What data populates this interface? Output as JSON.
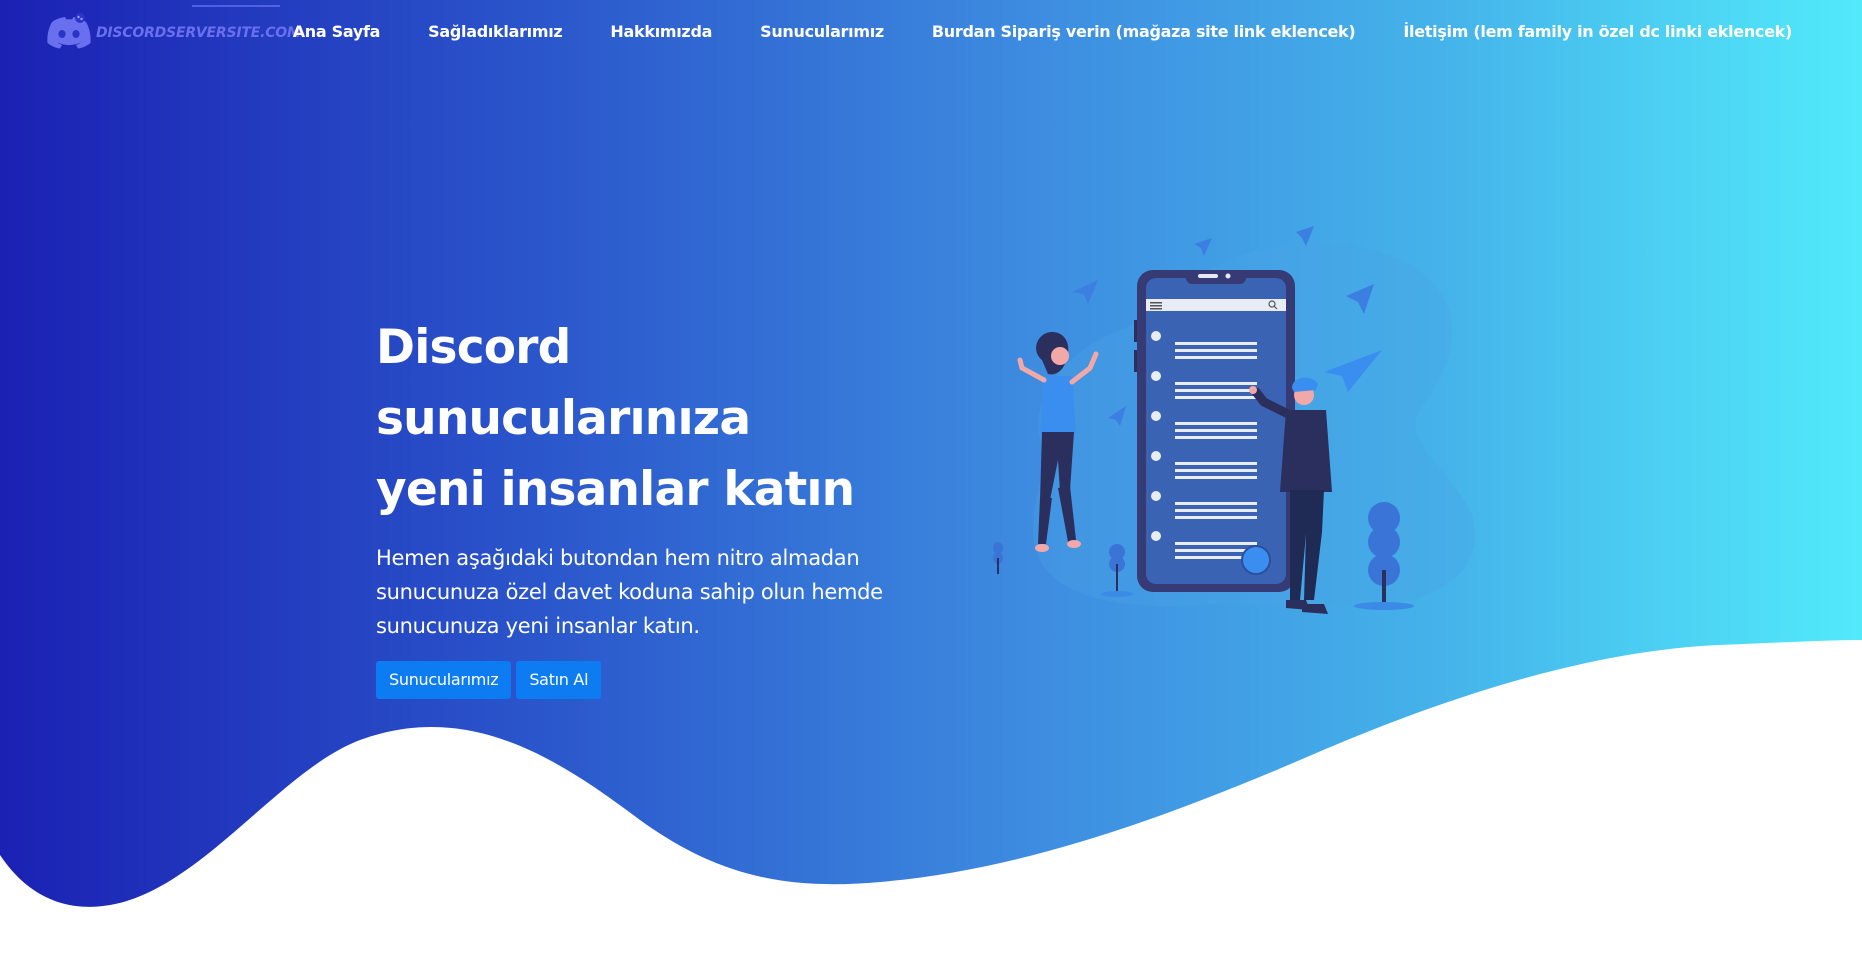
{
  "brand": {
    "logo_text": "DISCORDSERVERSITE.COM"
  },
  "nav": {
    "items": [
      {
        "label": "Ana Sayfa"
      },
      {
        "label": "Sağladıklarımız"
      },
      {
        "label": "Hakkımızda"
      },
      {
        "label": "Sunucularımız"
      },
      {
        "label": "Burdan Sipariş verin (mağaza site link eklencek)"
      },
      {
        "label": "İletişim (lem family in özel dc linki eklencek)"
      }
    ]
  },
  "hero": {
    "title_line1": "Discord sunucularınıza",
    "title_line2": "yeni insanlar katın",
    "subtitle": "Hemen aşağıdaki butondan hem nitro almadan sunucunuza özel davet koduna sahip olun hemde sunucunuza yeni insanlar katın.",
    "button_primary": "Sunucularımız",
    "button_secondary": "Satın Al"
  },
  "colors": {
    "gradient_start": "#1b21b3",
    "gradient_end": "#52eafb",
    "button": "#0d7cf2",
    "logo": "#6a6ff0"
  },
  "icons": {
    "logo": "discord-logo-icon",
    "illustration": "people-phone-illustration"
  }
}
